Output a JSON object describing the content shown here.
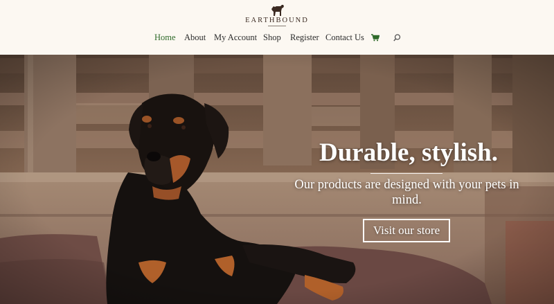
{
  "brand": {
    "name": "EARTHBOUND",
    "logo_icon": "dog-silhouette-icon"
  },
  "nav": {
    "items": [
      {
        "label": "Home",
        "active": true
      },
      {
        "label": "About"
      },
      {
        "label": "My Account"
      },
      {
        "label": "Shop"
      },
      {
        "label": "Register"
      },
      {
        "label": "Contact Us"
      }
    ],
    "cart_icon": "cart-icon",
    "search_icon": "search-icon"
  },
  "hero": {
    "title": "Durable, stylish.",
    "subtitle": "Our products are designed with your pets in mind.",
    "button_label": "Visit our store"
  },
  "colors": {
    "header_bg": "#fcf8f2",
    "nav_active": "#2f6a2a",
    "nav_text": "#2b2b2b",
    "hero_text": "#ffffff"
  }
}
